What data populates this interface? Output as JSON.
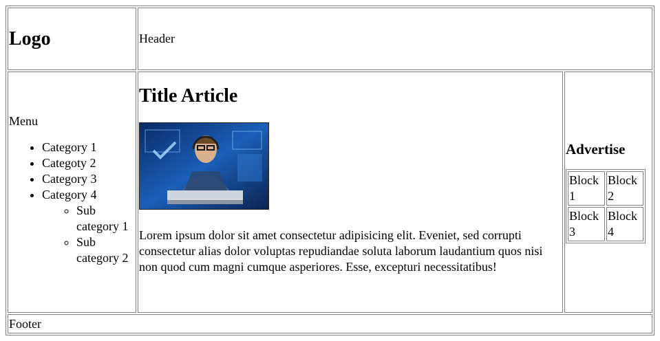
{
  "logo": "Logo",
  "header": {
    "text": "Header"
  },
  "menu": {
    "title": "Menu",
    "categories": [
      "Category 1",
      "Categoty 2",
      "Category 3",
      "Category 4"
    ],
    "subcategories": [
      "Sub category 1",
      "Sub category 2"
    ]
  },
  "article": {
    "title": "Title Article",
    "body": "Lorem ipsum dolor sit amet consectetur adipisicing elit. Eveniet, sed corrupti consectetur alias dolor voluptas repudiandae soluta laborum laudantium quos nisi non quod cum magni cumque asperiores. Esse, excepturi necessitatibus!"
  },
  "advertise": {
    "title": "Advertise",
    "blocks": [
      "Block 1",
      "Block 2",
      "Block 3",
      "Block 4"
    ]
  },
  "footer": {
    "text": "Footer"
  }
}
